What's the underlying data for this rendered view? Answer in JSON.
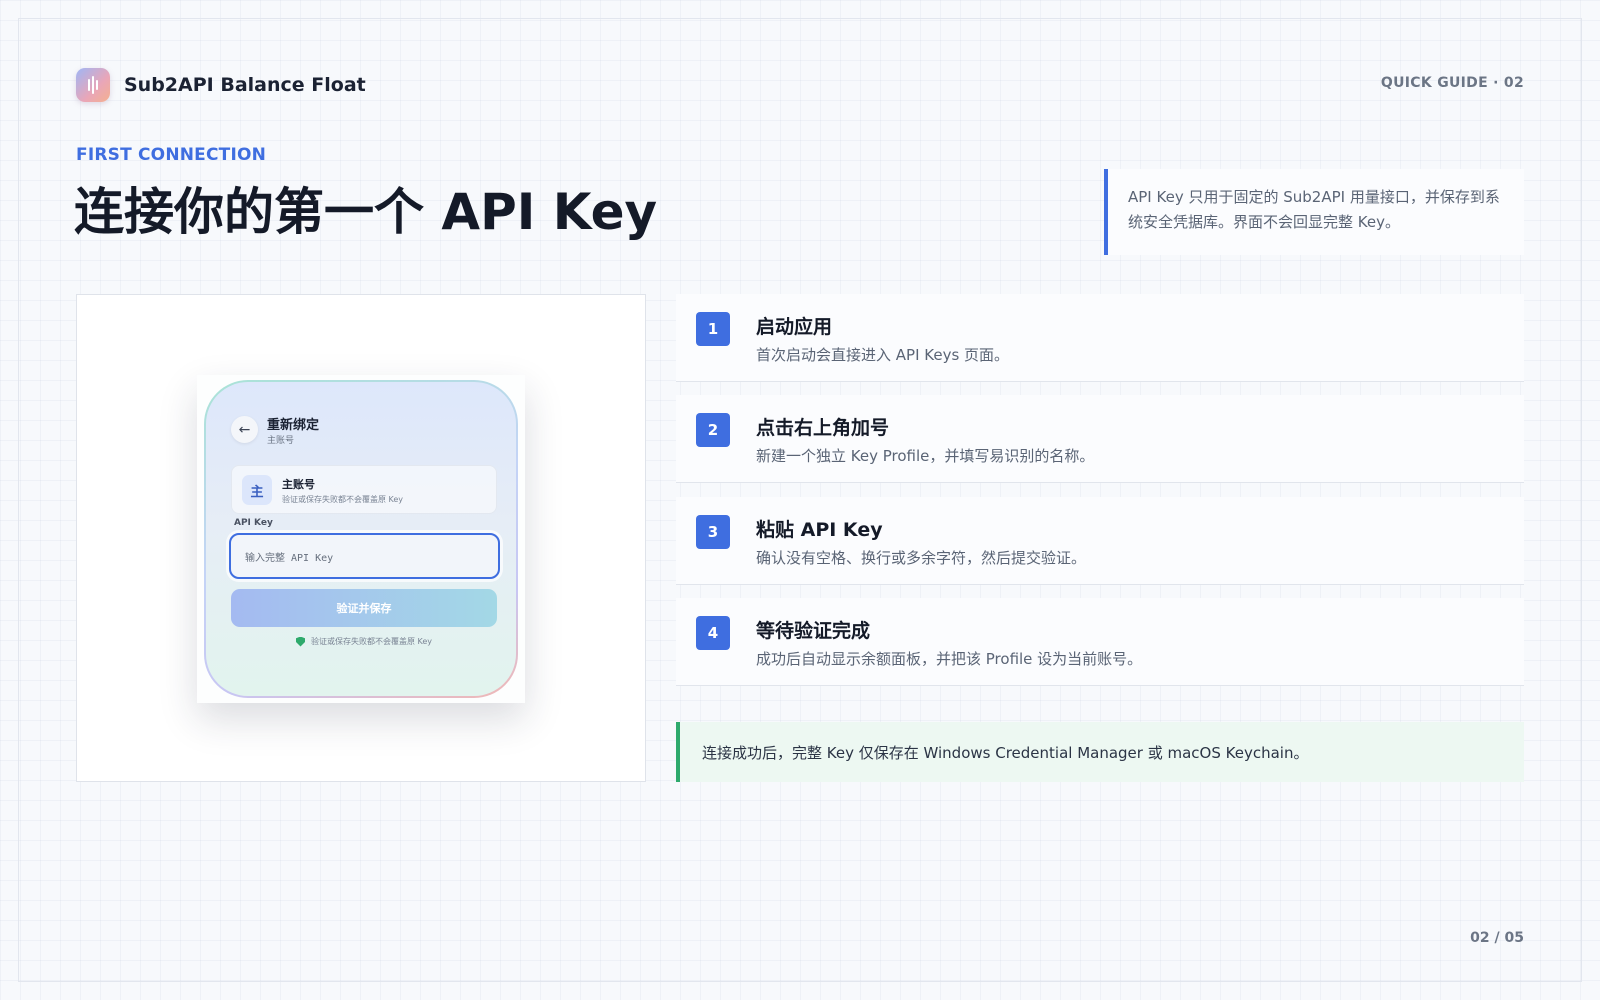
{
  "brand": {
    "name": "Sub2API Balance Float",
    "logo_icon": "sound-bars-icon"
  },
  "guide_tag": "QUICK GUIDE · 02",
  "eyebrow": "FIRST CONNECTION",
  "title": "连接你的第一个 API Key",
  "note": "API Key 只用于固定的 Sub2API 用量接口，并保存到系统安全凭据库。界面不会回显完整 Key。",
  "mock": {
    "back_icon": "arrow-left-icon",
    "back_glyph": "←",
    "title": "重新绑定",
    "subtitle": "主账号",
    "account": {
      "avatar": "主",
      "name": "主账号",
      "desc": "验证或保存失败都不会覆盖原 Key"
    },
    "field_label": "API Key",
    "field_placeholder": "输入完整 API Key",
    "submit_label": "验证并保存",
    "hint": "验证或保存失败都不会覆盖原 Key",
    "hint_icon": "shield-check-icon"
  },
  "steps": [
    {
      "num": "1",
      "title": "启动应用",
      "desc": "首次启动会直接进入 API Keys 页面。"
    },
    {
      "num": "2",
      "title": "点击右上角加号",
      "desc": "新建一个独立 Key Profile，并填写易识别的名称。"
    },
    {
      "num": "3",
      "title": "粘贴 API Key",
      "desc": "确认没有空格、换行或多余字符，然后提交验证。"
    },
    {
      "num": "4",
      "title": "等待验证完成",
      "desc": "成功后自动显示余额面板，并把该 Profile 设为当前账号。"
    }
  ],
  "success_note": "连接成功后，完整 Key 仅保存在 Windows Credential Manager 或 macOS Keychain。",
  "page_number": "02 / 05",
  "colors": {
    "accent": "#3f6ee0",
    "success": "#2eaa6c",
    "text": "#141a28"
  }
}
